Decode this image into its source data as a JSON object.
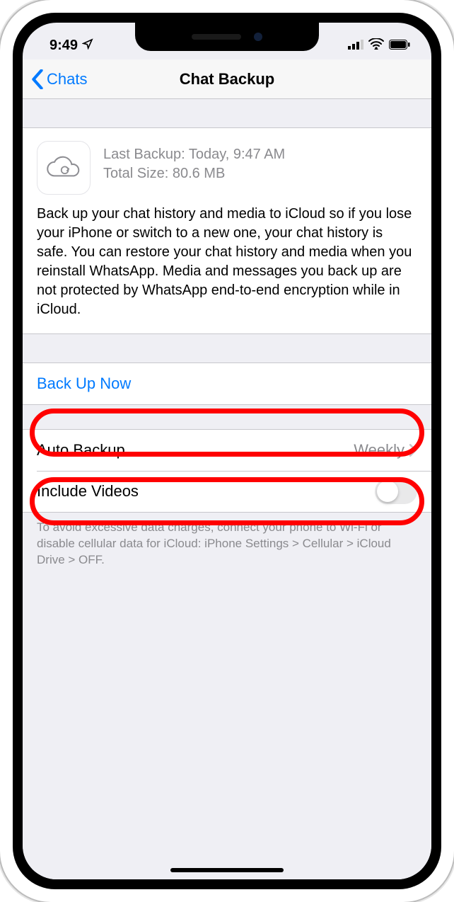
{
  "status": {
    "time": "9:49",
    "location_icon": "location-arrow"
  },
  "nav": {
    "back_label": "Chats",
    "title": "Chat Backup"
  },
  "info": {
    "last_backup_label": "Last Backup: Today, 9:47 AM",
    "total_size_label": "Total Size: 80.6 MB",
    "description": "Back up your chat history and media to iCloud so if you lose your iPhone or switch to a new one, your chat history is safe. You can restore your chat history and media when you reinstall WhatsApp. Media and messages you back up are not protected by WhatsApp end-to-end encryption while in iCloud."
  },
  "actions": {
    "backup_now": "Back Up Now",
    "auto_backup_label": "Auto Backup",
    "auto_backup_value": "Weekly",
    "include_videos_label": "Include Videos"
  },
  "footer": "To avoid excessive data charges, connect your phone to Wi-Fi or disable cellular data for iCloud: iPhone Settings > Cellular > iCloud Drive > OFF."
}
